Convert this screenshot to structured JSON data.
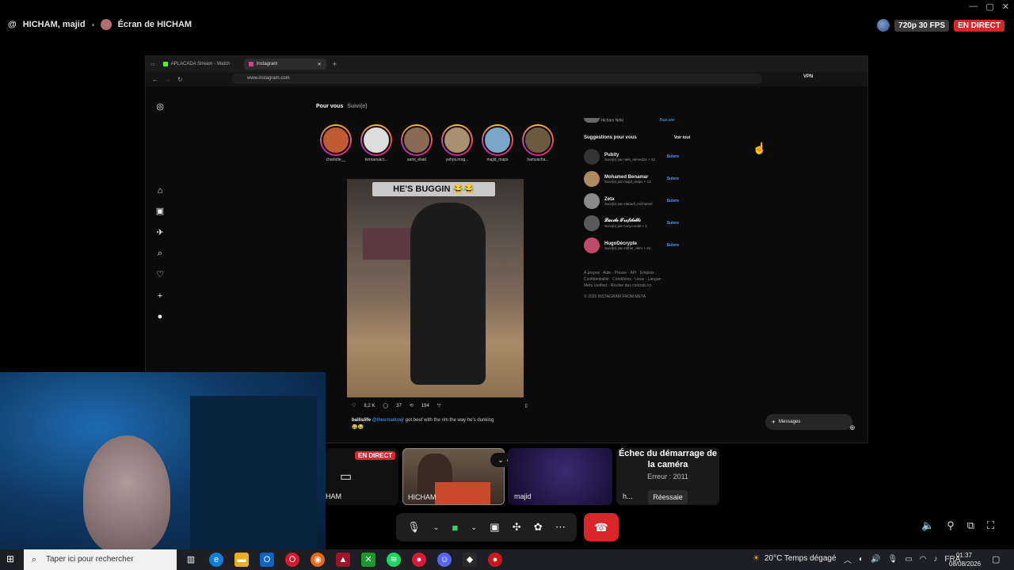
{
  "call": {
    "participants_title": "HICHAM, majid",
    "screen_share_title": "Écran de HICHAM",
    "quality": "720p 30 FPS",
    "live_label": "EN DIRECT",
    "window_controls": [
      "—",
      "▢",
      "✕"
    ]
  },
  "browser": {
    "tabs": [
      {
        "label": "APLACADA Stream - Watch"
      },
      {
        "label": "Instagram"
      }
    ],
    "url": "www.instagram.com",
    "vpn_label": "VPN"
  },
  "instagram": {
    "feed_tabs": [
      "Pour vous",
      "Suivi(e)"
    ],
    "stories": [
      "charlotte__",
      "kirmaouaci...",
      "sami_elaid",
      "yahya.mog...",
      "majid_maps",
      "hamzacha..."
    ],
    "post": {
      "overlay_text": "HE'S BUGGIN 😂😂",
      "likes": "8,2 K",
      "comments": "37",
      "reposts": "194",
      "caption_user": "ballislife",
      "caption_mention": "@theemarlowjr",
      "caption_text": "got beef with the rim the way he's dunking",
      "caption_emoji": "😂😂"
    },
    "current_user": "Hicham Nekt",
    "switch_label": "Basculer",
    "suggestions_title": "Suggestions pour vous",
    "see_all": "Voir tout",
    "suggestions": [
      {
        "name": "Pubity",
        "sub": "Suivi(e) par nekt_ahmed2x + 22",
        "follow": "Suivre"
      },
      {
        "name": "Mohamed Benamar",
        "sub": "Suivi(e) par majid_maps + 13",
        "follow": "Suivre"
      },
      {
        "name": "Zeta",
        "sub": "Suivi(e) par elabadi_michamel",
        "follow": "Suivre"
      },
      {
        "name": "𝓛𝓾𝓬𝓲𝓵𝓮 𝓣𝓻𝓲𝓯𝓲𝓵𝓮𝓽𝓽𝓲",
        "sub": "Suivi(e) par cozy.combi + 1",
        "follow": "Suivre"
      },
      {
        "name": "HugoDécrypte",
        "sub": "Suivi(e) par esther_dem + 31",
        "follow": "Suivre"
      }
    ],
    "footer_lines": [
      "À propos · Aide · Presse · API · Emplois ·",
      "Confidentialité · Conditions · Lieux · Langue ·",
      "Meta Verified · Résilier des contrats ici"
    ],
    "copyright": "© 2026 INSTAGRAM FROM META",
    "messages_label": "Messages"
  },
  "participants": {
    "screen_tile_name": "HAM",
    "screen_tile_live": "EN DIRECT",
    "hicham_label": "HICHAM",
    "majid_label": "majid",
    "error_title": "Échec du démarrage de la caméra",
    "error_code": "Erreur : 2011",
    "error_tile_initial": "h...",
    "retry_label": "Réessaie"
  },
  "taskbar": {
    "search_placeholder": "Taper ici pour rechercher",
    "weather": "20°C  Temps dégagé",
    "language": "FRA",
    "time": "01:37",
    "date": "08/08/2026"
  },
  "colors": {
    "live_red": "#d8262b",
    "instagram_link": "#4aa0ff",
    "hangup": "#d8262b"
  }
}
